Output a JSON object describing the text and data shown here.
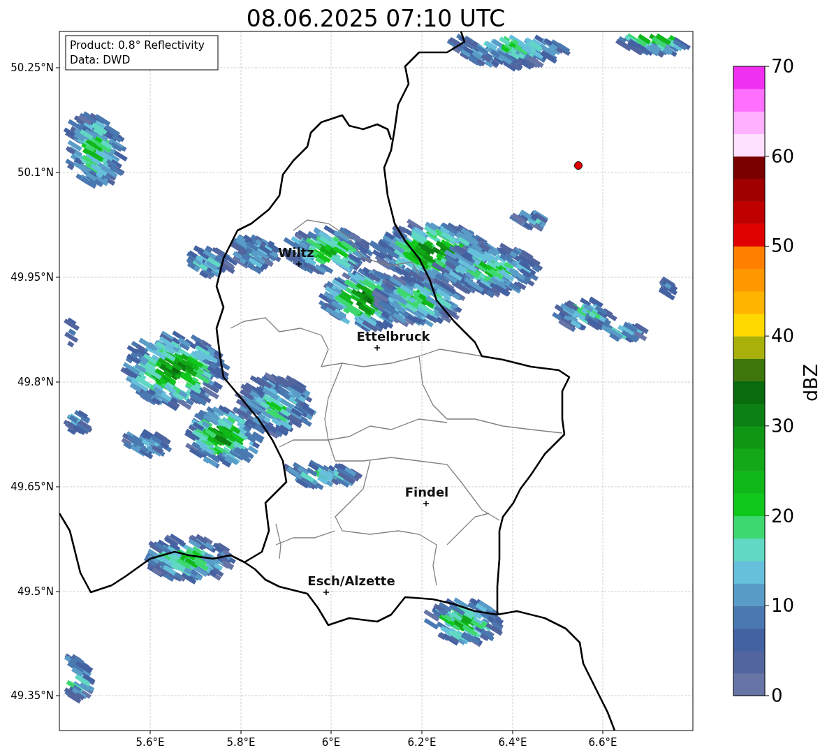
{
  "title": "08.06.2025 07:10 UTC",
  "info_box": [
    "Product: 0.8° Reflectivity",
    "Data: DWD"
  ],
  "map": {
    "cities": [
      {
        "name": "Wiltz"
      },
      {
        "name": "Ettelbruck"
      },
      {
        "name": "Findel"
      },
      {
        "name": "Esch/Alzette"
      }
    ],
    "y_ticks": [
      "50.25°N",
      "50.1°N",
      "49.95°N",
      "49.8°N",
      "49.65°N",
      "49.5°N",
      "49.35°N"
    ],
    "x_ticks": [
      "5.6°E",
      "5.8°E",
      "6°E",
      "6.2°E",
      "6.4°E",
      "6.6°E"
    ]
  },
  "colorbar": {
    "label": "dBZ",
    "ticks": [
      "70",
      "60",
      "50",
      "40",
      "30",
      "20",
      "10",
      "0"
    ],
    "segments": [
      {
        "color": "#6674a6"
      },
      {
        "color": "#52659e"
      },
      {
        "color": "#4462a2"
      },
      {
        "color": "#4a78b0"
      },
      {
        "color": "#5a9cc8"
      },
      {
        "color": "#66c0dc"
      },
      {
        "color": "#60d8c4"
      },
      {
        "color": "#3ed870"
      },
      {
        "color": "#10c81c"
      },
      {
        "color": "#10b81a"
      },
      {
        "color": "#12a818"
      },
      {
        "color": "#0e9614"
      },
      {
        "color": "#0c8012"
      },
      {
        "color": "#0a6a0e"
      },
      {
        "color": "#3e760c"
      },
      {
        "color": "#a8b00a"
      },
      {
        "color": "#ffd800"
      },
      {
        "color": "#ffb400"
      },
      {
        "color": "#ff9800"
      },
      {
        "color": "#ff8000"
      },
      {
        "color": "#e00000"
      },
      {
        "color": "#c00000"
      },
      {
        "color": "#a00000"
      },
      {
        "color": "#7a0000"
      },
      {
        "color": "#ffe0ff"
      },
      {
        "color": "#ffb0ff"
      },
      {
        "color": "#ff70ff"
      },
      {
        "color": "#f030f0"
      }
    ]
  }
}
